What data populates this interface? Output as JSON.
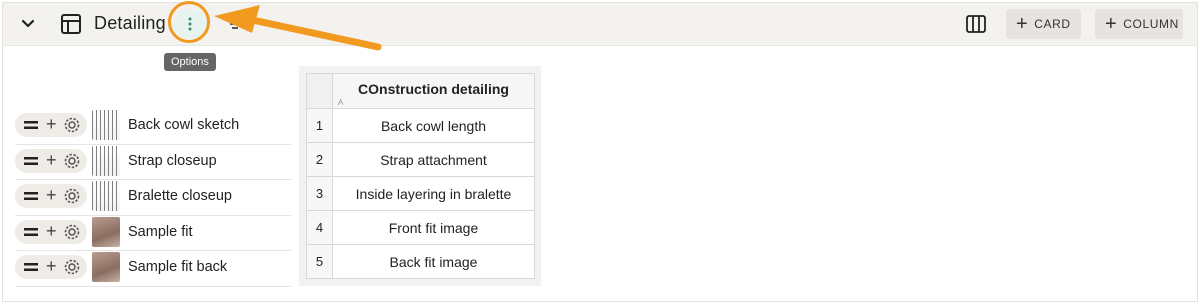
{
  "header": {
    "title": "Detailing",
    "options_tooltip": "Options",
    "buttons": {
      "card_label": "CARD",
      "column_label": "COLUMN"
    },
    "icons": {
      "collapse": "chevron-down-icon",
      "layout": "layout-icon",
      "options": "vertical-dots-icon",
      "filter": "filter-icon",
      "columns": "columns-icon"
    }
  },
  "colors": {
    "highlight": "#f29a1f",
    "options_bg": "#e6f3ef",
    "bar_bg": "#f4f2ee"
  },
  "cards": [
    {
      "label": "Back cowl sketch",
      "thumb": "sketch"
    },
    {
      "label": "Strap closeup",
      "thumb": "sketch"
    },
    {
      "label": "Bralette closeup",
      "thumb": "sketch"
    },
    {
      "label": "Sample fit",
      "thumb": "photo"
    },
    {
      "label": "Sample fit back",
      "thumb": "photo"
    }
  ],
  "table": {
    "column_header": "COnstruction detailing",
    "column_letter": "A",
    "rows": [
      {
        "num": "1",
        "value": "Back cowl length"
      },
      {
        "num": "2",
        "value": "Strap attachment"
      },
      {
        "num": "3",
        "value": "Inside layering in bralette"
      },
      {
        "num": "4",
        "value": "Front fit image"
      },
      {
        "num": "5",
        "value": "Back fit image"
      }
    ]
  }
}
